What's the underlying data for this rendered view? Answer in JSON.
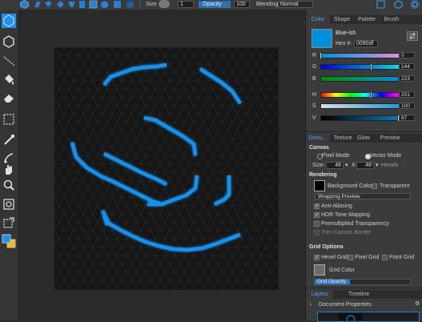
{
  "topbar": {
    "size_label": "Size",
    "size_value": "1",
    "opacity_label": "Opacity",
    "opacity_value": "100",
    "blending_label": "Blending:",
    "blending_value": "Normal"
  },
  "color_panel": {
    "tabs": [
      "Color",
      "Shape",
      "Palette",
      "Brush"
    ],
    "color_name": "Blue-ish",
    "hex_label": "Hex #:",
    "hex_value": "0090df",
    "swatch_color": "#0090df",
    "channels": [
      {
        "label": "R",
        "value": "0",
        "level": 0.0
      },
      {
        "label": "G",
        "value": "144",
        "level": 0.565
      },
      {
        "label": "B",
        "value": "223",
        "level": 0.875
      },
      {
        "label": "H",
        "value": "201",
        "level": 0.56
      },
      {
        "label": "S",
        "value": "100",
        "level": 1.0
      },
      {
        "label": "V",
        "value": "87",
        "level": 0.87
      }
    ]
  },
  "doc_panel": {
    "tabs": [
      "Docu...",
      "Texture",
      "Glow",
      "Preview"
    ],
    "canvas_heading": "Canvas",
    "pixel_mode": "Pixel Mode",
    "vector_mode": "Vector Mode",
    "size_label": "Size:",
    "width": "48",
    "x": "X",
    "height": "48",
    "units": "Hexels",
    "rendering_heading": "Rendering",
    "background_color": "Background Color",
    "transparent": "Transparent",
    "wrapping_preview": "Wrapping Preview",
    "anti_aliasing": "Anti-Aliasing",
    "hdr": "HDR Tone Mapping",
    "premultiplied": "Premultiplied Transparency",
    "trim": "Trim Canvas Border",
    "grid_heading": "Grid Options",
    "hexel_grid": "Hexel Grid",
    "pixel_grid": "Pixel Grid",
    "point_grid": "Point Grid",
    "grid_color": "Grid Color",
    "grid_opacity": "Grid Opacity"
  },
  "layers_panel": {
    "tabs": [
      "Layers",
      "Timeline"
    ],
    "document_properties": "Document Properties"
  },
  "colors": {
    "accent": "#1e9bff",
    "stroke": "#1a8fe6"
  }
}
